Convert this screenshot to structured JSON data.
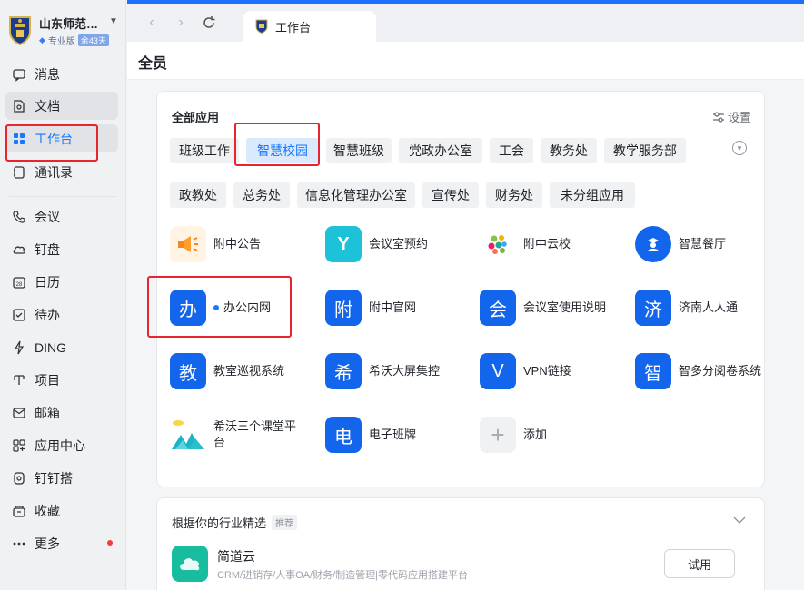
{
  "org": {
    "name": "山东师范…",
    "edition": "专业版",
    "badge": "余43天"
  },
  "nav": [
    {
      "label": "消息",
      "icon": "message-icon"
    },
    {
      "label": "文档",
      "icon": "document-icon"
    },
    {
      "label": "工作台",
      "icon": "workbench-icon"
    },
    {
      "label": "通讯录",
      "icon": "contacts-icon"
    },
    {
      "label": "会议",
      "icon": "phone-icon"
    },
    {
      "label": "钉盘",
      "icon": "cloud-drive-icon"
    },
    {
      "label": "日历",
      "icon": "calendar-icon"
    },
    {
      "label": "待办",
      "icon": "todo-icon"
    },
    {
      "label": "DING",
      "icon": "ding-icon"
    },
    {
      "label": "项目",
      "icon": "project-icon"
    },
    {
      "label": "邮箱",
      "icon": "mail-icon"
    },
    {
      "label": "应用中心",
      "icon": "app-center-icon"
    },
    {
      "label": "钉钉搭",
      "icon": "dingda-icon"
    },
    {
      "label": "收藏",
      "icon": "favorite-icon"
    },
    {
      "label": "更多",
      "icon": "more-icon"
    }
  ],
  "tab": {
    "label": "工作台"
  },
  "page": {
    "title": "全员"
  },
  "apps_card": {
    "title": "全部应用",
    "settings": "设置",
    "categories": [
      "班级工作",
      "智慧校园",
      "智慧班级",
      "党政办公室",
      "工会",
      "教务处",
      "教学服务部",
      "政教处",
      "总务处",
      "信息化管理办公室",
      "宣传处",
      "财务处",
      "未分组应用"
    ],
    "selected_category": "智慧校园",
    "apps": [
      {
        "label": "附中公告",
        "glyph": "",
        "icon": "megaphone-icon"
      },
      {
        "label": "会议室预约",
        "glyph": "Y",
        "icon": "meeting-room-icon"
      },
      {
        "label": "附中云校",
        "glyph": "",
        "icon": "cloud-school-icon"
      },
      {
        "label": "智慧餐厅",
        "glyph": "",
        "icon": "canteen-icon"
      },
      {
        "label": "办公内网",
        "glyph": "办",
        "icon": "office-intranet-icon"
      },
      {
        "label": "附中官网",
        "glyph": "附",
        "icon": "official-site-icon"
      },
      {
        "label": "会议室使用说明",
        "glyph": "会",
        "icon": "meeting-guide-icon"
      },
      {
        "label": "济南人人通",
        "glyph": "济",
        "icon": "jinan-icon"
      },
      {
        "label": "教室巡视系统",
        "glyph": "教",
        "icon": "classroom-patrol-icon"
      },
      {
        "label": "希沃大屏集控",
        "glyph": "希",
        "icon": "seewo-screen-icon"
      },
      {
        "label": "VPN链接",
        "glyph": "V",
        "icon": "vpn-icon"
      },
      {
        "label": "智多分阅卷系统",
        "glyph": "智",
        "icon": "grading-icon"
      },
      {
        "label": "希沃三个课堂平台",
        "glyph": "",
        "icon": "seewo-class-icon"
      },
      {
        "label": "电子班牌",
        "glyph": "电",
        "icon": "class-board-icon"
      },
      {
        "label": "添加",
        "glyph": "+",
        "icon": "add-icon"
      }
    ]
  },
  "recommend": {
    "title": "根据你的行业精选",
    "tag": "推荐",
    "app_name": "简道云",
    "app_desc": "CRM/进销存/人事OA/财务/制造管理|零代码应用搭建平台",
    "try_label": "试用"
  },
  "colors": {
    "accent": "#1677ff",
    "app_blue": "#1366ec",
    "highlight_box": "#e8242c"
  }
}
